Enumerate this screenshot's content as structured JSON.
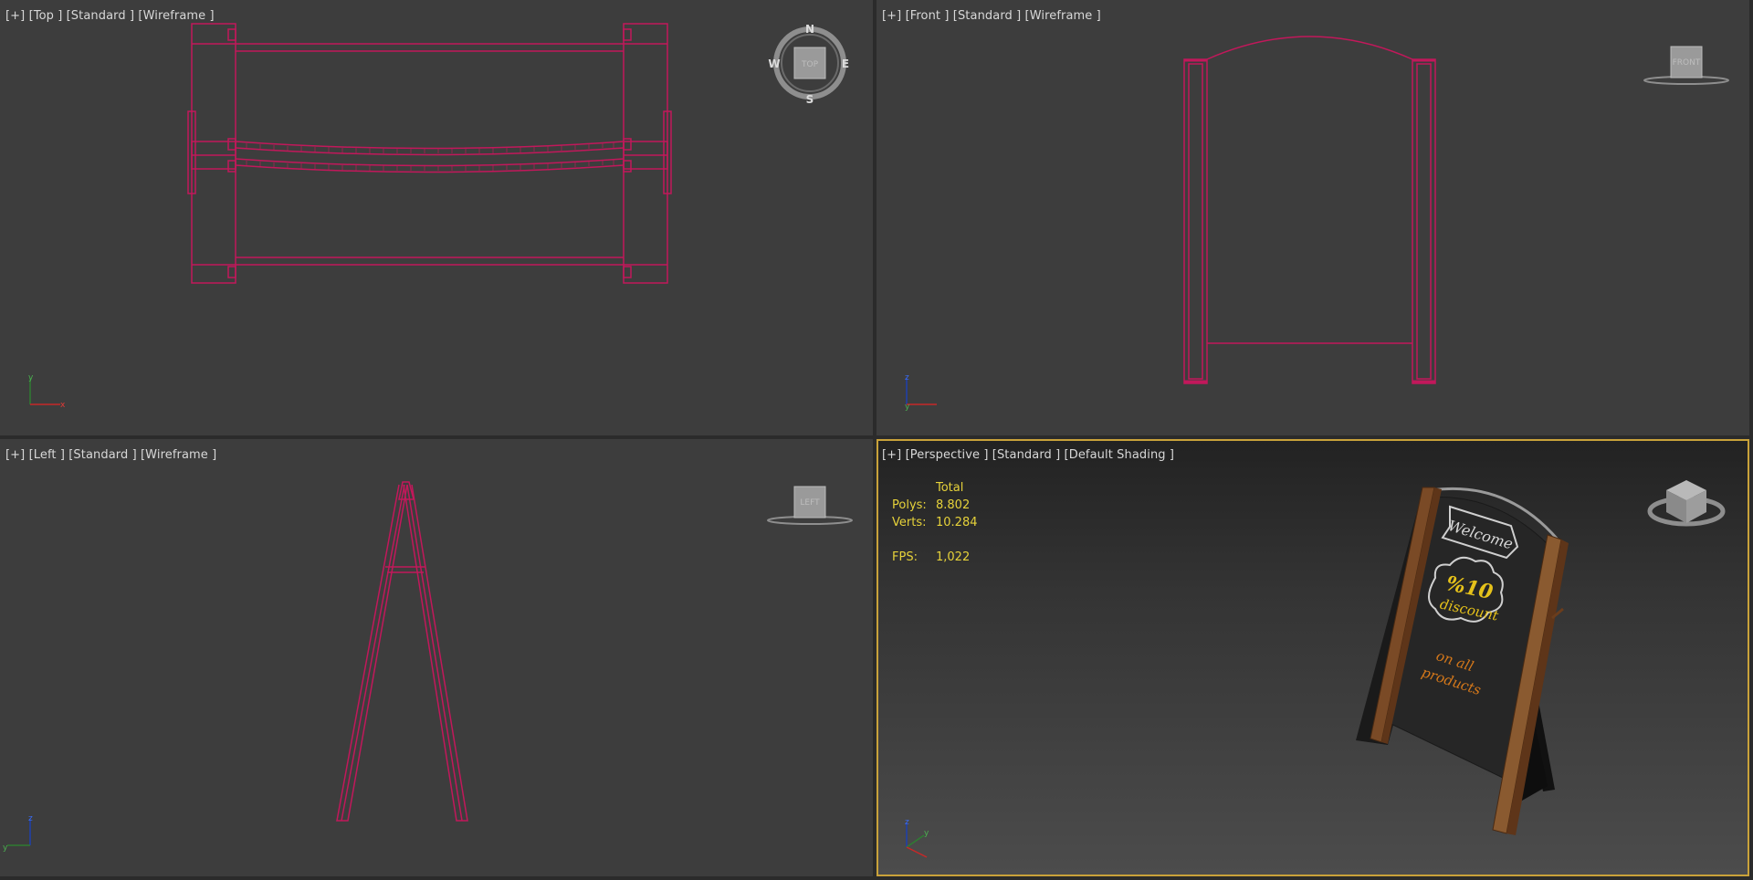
{
  "viewports": {
    "top": {
      "labels": [
        "[+]",
        "[Top ]",
        "[Standard ]",
        "[Wireframe ]"
      ],
      "viewcube": {
        "face": "TOP",
        "compass": [
          "N",
          "S",
          "W",
          "E"
        ]
      },
      "axes": [
        "y",
        "x"
      ]
    },
    "front": {
      "labels": [
        "[+]",
        "[Front ]",
        "[Standard ]",
        "[Wireframe ]"
      ],
      "viewcube": {
        "face": "FRONT"
      },
      "axes": [
        "z",
        "y"
      ]
    },
    "left": {
      "labels": [
        "[+]",
        "[Left ]",
        "[Standard ]",
        "[Wireframe ]"
      ],
      "viewcube": {
        "face": "LEFT"
      },
      "axes": [
        "z",
        "y"
      ]
    },
    "perspective": {
      "labels": [
        "[+]",
        "[Perspective ]",
        "[Standard ]",
        "[Default Shading ]"
      ],
      "stats": {
        "header": "Total",
        "polys_label": "Polys:",
        "polys": "8.802",
        "verts_label": "Verts:",
        "verts": "10.284",
        "fps_label": "FPS:",
        "fps": "1,022"
      },
      "axes": [
        "z",
        "y"
      ],
      "sign": {
        "line1": "Welcome",
        "line2": "%10",
        "line3": "discount",
        "line4": "on all",
        "line5": "products"
      }
    }
  },
  "colors": {
    "wire": "#c2185b",
    "viewport_bg": "#3d3d3d",
    "active_border": "#c9a23a",
    "stats_text": "#e6d23a",
    "wood": "#8a5a30",
    "board": "#262626"
  }
}
